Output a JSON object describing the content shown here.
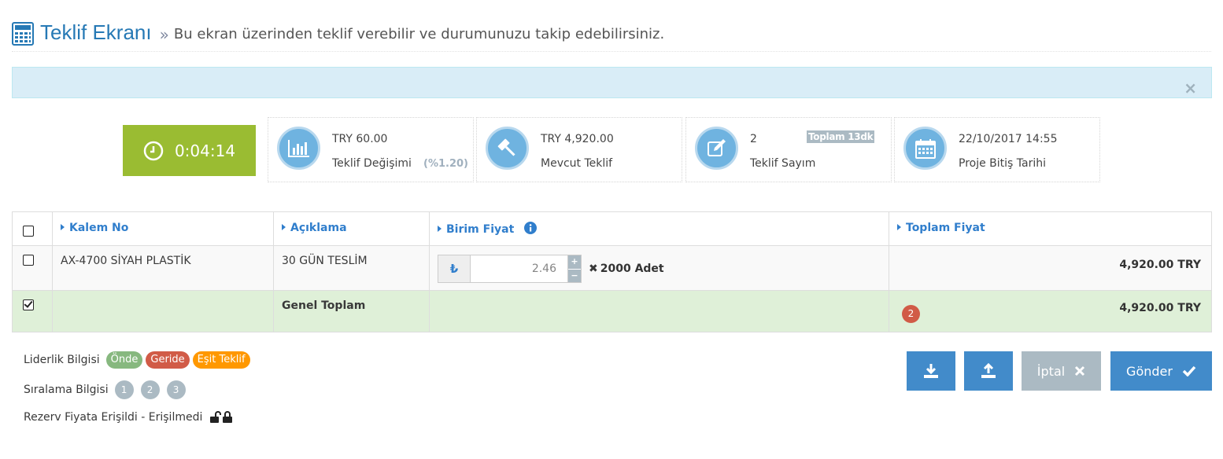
{
  "header": {
    "title": "Teklif Ekranı",
    "separator": "»",
    "subtitle": "Bu ekran üzerinden teklif verebilir ve durumunuzu takip edebilirsiniz."
  },
  "alert": {
    "close_glyph": "×"
  },
  "timer": {
    "value": "0:04:14"
  },
  "stats": {
    "change": {
      "value": "TRY 60.00",
      "label": "Teklif Değişimi",
      "percent": "(%1.20)"
    },
    "current": {
      "value": "TRY 4,920.00",
      "label": "Mevcut Teklif"
    },
    "count": {
      "value": "2",
      "label": "Teklif Sayım",
      "badge": "Toplam 13dk"
    },
    "deadline": {
      "value": "22/10/2017 14:55",
      "label": "Proje Bitiş Tarihi"
    }
  },
  "table": {
    "headers": {
      "kalem": "Kalem No",
      "aciklama": "Açıklama",
      "birim": "Birim Fiyat",
      "toplam": "Toplam Fiyat"
    },
    "row": {
      "kalem": "AX-4700 SİYAH PLASTİK",
      "aciklama": "30 GÜN TESLİM",
      "currency_symbol": "₺",
      "unit_price": "2.46",
      "qty_prefix": "✖",
      "quantity": "2000 Adet",
      "total": "4,920.00 TRY"
    },
    "total_row": {
      "label": "Genel Toplam",
      "rank_badge": "2",
      "total": "4,920.00 TRY"
    }
  },
  "legend": {
    "leadership_label": "Liderlik Bilgisi",
    "ahead": "Önde",
    "behind": "Geride",
    "equal": "Eşit Teklif",
    "ranking_label": "Sıralama Bilgisi",
    "ranks": [
      "1",
      "2",
      "3"
    ],
    "reserve_label": "Rezerv Fiyata Erişildi - Erişilmedi"
  },
  "buttons": {
    "cancel": "İptal",
    "send": "Gönder"
  },
  "colors": {
    "accent": "#2679b5",
    "timer": "#9abc32",
    "ahead": "#87b87f",
    "behind": "#d15b47",
    "equal": "#ff9800"
  }
}
